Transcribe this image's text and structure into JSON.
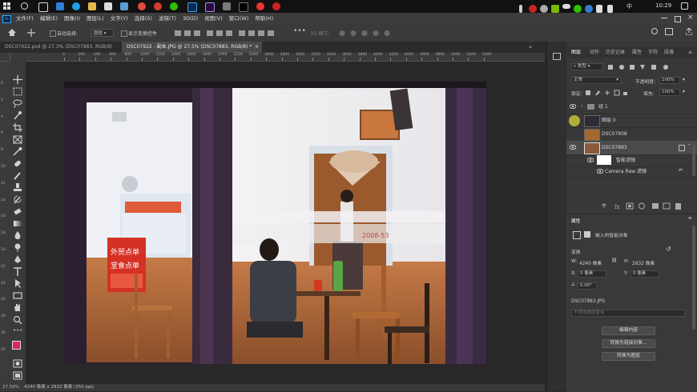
{
  "taskbar": {
    "time": "10:29",
    "input_method": "中"
  },
  "menu": [
    "文件(F)",
    "编辑(E)",
    "图像(I)",
    "图层(L)",
    "文字(Y)",
    "选择(S)",
    "滤镜(T)",
    "3D(D)",
    "视图(V)",
    "窗口(W)",
    "帮助(H)"
  ],
  "options": {
    "auto_select_label": "自动选择:",
    "auto_select_value": "图层",
    "show_transform_label": "显示变换控件",
    "mode_3d": "3D 模式:"
  },
  "tabs": [
    {
      "label": "DSC07922.psd @ 27.3% (DSC07883, RGB/8) *",
      "active": false
    },
    {
      "label": "DSC07922 - 副本.JPG @ 27.5% (DSC07883, RGB/8) *",
      "active": true
    }
  ],
  "ruler_top": [
    "0",
    "200",
    "400",
    "600",
    "800",
    "1000",
    "1200",
    "1400",
    "1600",
    "1800",
    "2000",
    "2200",
    "2400",
    "2600",
    "2800",
    "3000",
    "3200",
    "3400",
    "3600",
    "3800",
    "4000",
    "4200",
    "4400",
    "4600",
    "4800",
    "5000",
    "5200",
    "5400"
  ],
  "ruler_left": [
    "0",
    "2",
    "4",
    "6",
    "8",
    "10",
    "12",
    "14",
    "16",
    "18",
    "20",
    "22",
    "24",
    "26",
    "28",
    "30",
    "32"
  ],
  "status": {
    "zoom": "27.59%",
    "doc_info": "4240 像素 x 2832 像素 (350 ppi)"
  },
  "photo": {
    "sign1": "外贸点单",
    "sign2": "堂食点单",
    "glass_text": "2008-53"
  },
  "panel_tabs": [
    "图层",
    "动作",
    "历史记录",
    "属性",
    "字符",
    "段落"
  ],
  "layers_panel": {
    "kind_label": "类型",
    "blend_mode": "正常",
    "opacity_label": "不透明度:",
    "opacity_value": "100%",
    "lock_label": "锁定:",
    "fill_label": "填充:",
    "fill_value": "100%",
    "layers": [
      {
        "name": "组 1",
        "type": "group",
        "visible": true
      },
      {
        "name": "图层 0",
        "type": "layer",
        "visible": false
      },
      {
        "name": "DSC07908",
        "type": "layer",
        "visible": false
      },
      {
        "name": "DSC07883",
        "type": "smart",
        "visible": true,
        "selected": true
      }
    ],
    "smart_filters_label": "智能滤镜",
    "camera_raw_label": "Camera Raw 滤镜"
  },
  "properties": {
    "title": "属性",
    "object_type": "嵌入的智能对象",
    "transform_label": "变换",
    "w_label": "W:",
    "w_value": "4240 像素",
    "h_label": "H:",
    "h_value": "2832 像素",
    "x_label": "X:",
    "x_value": "0 像素",
    "y_label": "Y:",
    "y_value": "0 像素",
    "angle_value": "0.00°",
    "filename": "DSC07883.JPG",
    "comp_placeholder": "不适用图层复合",
    "btn_edit": "编辑内容",
    "btn_convert_linked": "转换为链接对象...",
    "btn_convert_layers": "转换为图层"
  }
}
